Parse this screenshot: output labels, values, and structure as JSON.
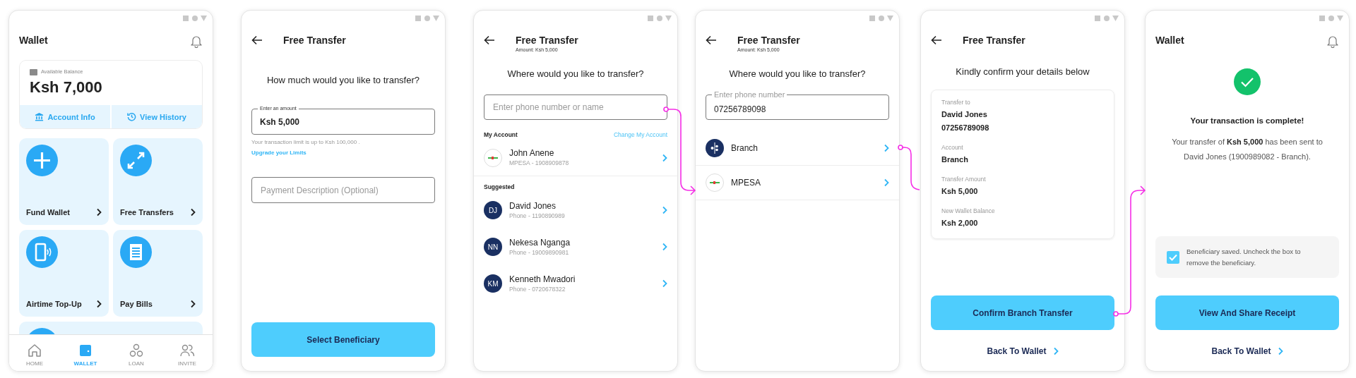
{
  "screens": [
    {
      "kind": "wallet",
      "title": "Wallet",
      "balance": {
        "label": "Available Balance",
        "amount": "Ksh 7,000"
      },
      "balance_actions": [
        "Account Info",
        "View History"
      ],
      "tiles": [
        {
          "label": "Fund Wallet"
        },
        {
          "label": "Free Transfers"
        },
        {
          "label": "Airtime Top-Up"
        },
        {
          "label": "Pay Bills"
        }
      ],
      "bottom_nav": [
        {
          "label": "HOME",
          "selected": false
        },
        {
          "label": "WALLET",
          "selected": true
        },
        {
          "label": "LOAN",
          "selected": false
        },
        {
          "label": "INVITE",
          "selected": false
        }
      ]
    },
    {
      "kind": "amount",
      "title": "Free Transfer",
      "prompt": "How much would you like to transfer?",
      "amount_field": {
        "label": "Enter an amount",
        "value": "Ksh 5,000"
      },
      "limit_note": "Your transaction limit is up to Ksh 100,000 .",
      "upgrade_link": "Upgrade your Limits",
      "description_field": {
        "placeholder": "Payment Description (Optional)"
      },
      "button": "Select Beneficiary"
    },
    {
      "kind": "recipient",
      "title": "Free Transfer",
      "subtitle": "Amount: Ksh 5,000",
      "prompt": "Where would you like to transfer?",
      "search_field": {
        "placeholder": "Enter phone number or name"
      },
      "my_account": {
        "heading": "My Account",
        "action": "Change My Account",
        "name": "John Anene",
        "detail": "MPESA - 1908909878"
      },
      "suggested": {
        "heading": "Suggested",
        "contacts": [
          {
            "initials": "DJ",
            "name": "David Jones",
            "detail": "Phone - 1190890989"
          },
          {
            "initials": "NN",
            "name": "Nekesa Nganga",
            "detail": "Phone - 19009890981"
          },
          {
            "initials": "KM",
            "name": "Kenneth Mwadori",
            "detail": "Phone - 0720678322"
          }
        ]
      }
    },
    {
      "kind": "account",
      "title": "Free Transfer",
      "subtitle": "Amount: Ksh 5,000",
      "prompt": "Where would you like to transfer?",
      "phone_field": {
        "label": "Enter phone number",
        "value": "07256789098"
      },
      "accounts": [
        {
          "name": "Branch",
          "kind": "dots"
        },
        {
          "name": "MPESA",
          "kind": "mpesa"
        }
      ]
    },
    {
      "kind": "confirm",
      "title": "Free Transfer",
      "prompt": "Kindly confirm your details below",
      "details": [
        {
          "label": "Transfer to",
          "values": [
            "David Jones",
            "07256789098"
          ]
        },
        {
          "label": "Account",
          "values": [
            "Branch"
          ]
        },
        {
          "label": "Transfer Amount",
          "values": [
            "Ksh 5,000"
          ]
        },
        {
          "label": "New Wallet Balance",
          "values": [
            "Ksh 2,000"
          ]
        }
      ],
      "button": "Confirm Branch Transfer",
      "back_link": "Back To Wallet"
    },
    {
      "kind": "success",
      "title": "Wallet",
      "heading": "Your transaction is complete!",
      "message": "Your transfer of **Ksh 5,000** has been sent to David Jones (1900989082 - Branch).",
      "beneficiary": {
        "checked": true,
        "text": "Beneficiary saved. Uncheck the box to remove the beneficiary."
      },
      "button": "View And Share Receipt",
      "back_link": "Back To Wallet"
    }
  ]
}
